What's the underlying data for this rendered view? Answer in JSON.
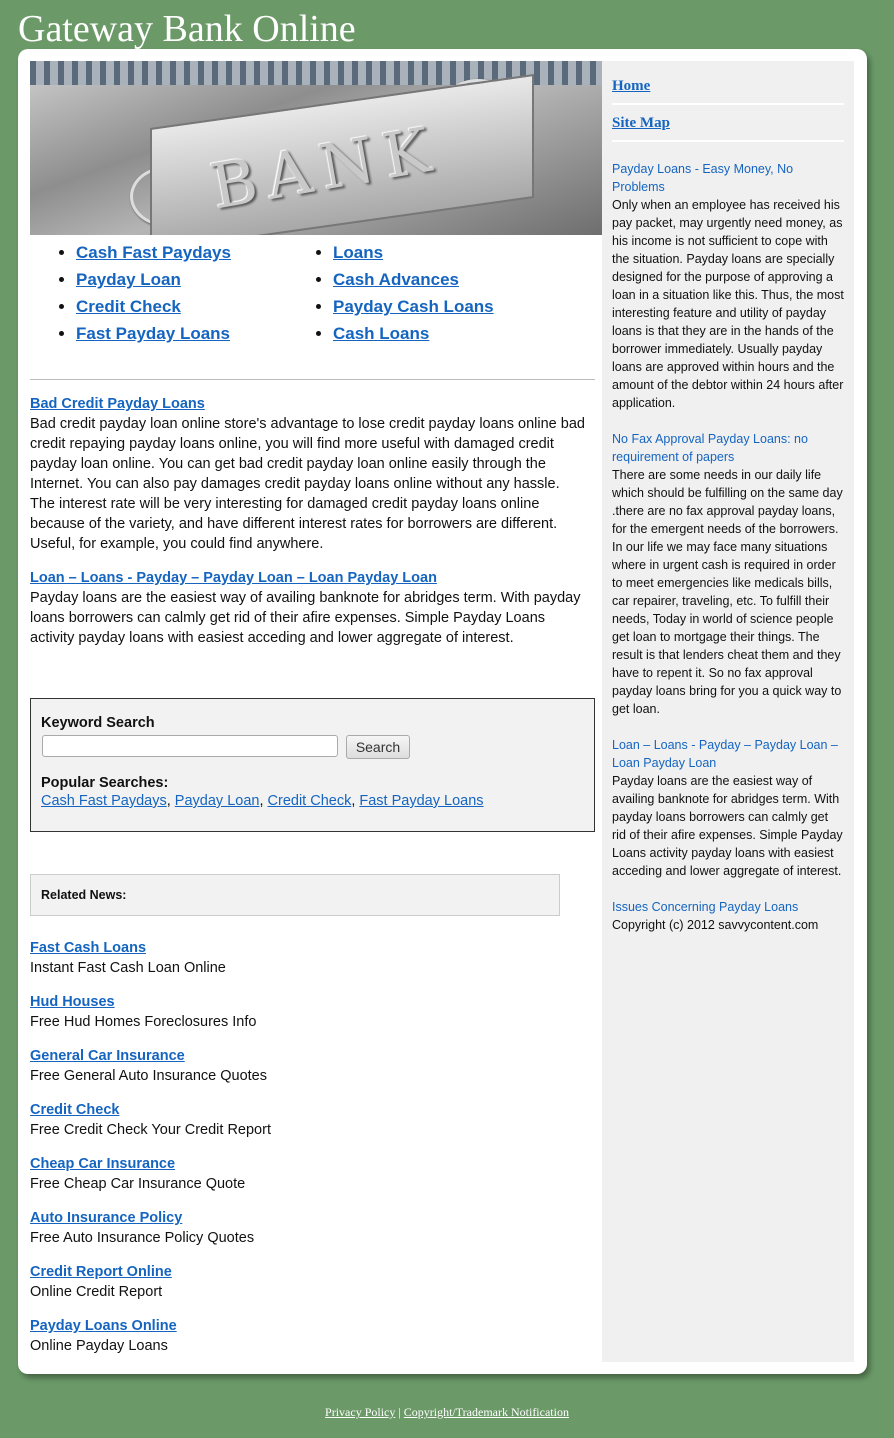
{
  "site": {
    "title": "Gateway Bank Online"
  },
  "hero": {
    "word": "BANK"
  },
  "top_links": {
    "col1": [
      "Cash Fast Paydays",
      "Payday Loan",
      "Credit Check",
      "Fast Payday Loans"
    ],
    "col2": [
      "Loans",
      "Cash Advances",
      "Payday Cash Loans",
      "Cash Loans"
    ]
  },
  "articles": [
    {
      "title": "Bad Credit Payday Loans",
      "body": "Bad credit payday loan online store's advantage to lose credit payday loans online bad credit repaying payday loans online, you will find more useful with damaged credit payday loan online. You can get bad credit payday loan online easily through the Internet. You can also pay damages credit payday loans online without any hassle. The interest rate will be very interesting for damaged credit payday loans online because of the variety, and have different interest rates for borrowers are different. Useful, for example, you could find anywhere."
    },
    {
      "title": "Loan – Loans - Payday – Payday Loan – Loan Payday Loan",
      "body": "Payday loans are the easiest way of availing banknote for abridges term. With payday loans borrowers can calmly get rid of their afire expenses. Simple Payday Loans activity payday loans with easiest acceding and lower aggregate of interest."
    }
  ],
  "search": {
    "label": "Keyword Search",
    "placeholder": "",
    "button": "Search",
    "popular_label": "Popular Searches:",
    "popular": [
      "Cash Fast Paydays",
      "Payday Loan",
      "Credit Check",
      "Fast Payday Loans"
    ],
    "separator": ", "
  },
  "related": {
    "label": "Related News:"
  },
  "news": [
    {
      "title": "Fast Cash Loans",
      "desc": "Instant Fast Cash Loan Online"
    },
    {
      "title": "Hud Houses",
      "desc": "Free Hud Homes Foreclosures Info"
    },
    {
      "title": "General Car Insurance",
      "desc": "Free General Auto Insurance Quotes"
    },
    {
      "title": "Credit Check",
      "desc": "Free Credit Check Your Credit Report"
    },
    {
      "title": "Cheap Car Insurance",
      "desc": "Free Cheap Car Insurance Quote"
    },
    {
      "title": "Auto Insurance Policy",
      "desc": "Free Auto Insurance Policy Quotes"
    },
    {
      "title": "Credit Report Online",
      "desc": "Online Credit Report"
    },
    {
      "title": "Payday Loans Online",
      "desc": "Online Payday Loans"
    }
  ],
  "sidebar": {
    "nav": [
      "Home",
      "Site Map"
    ],
    "posts": [
      {
        "title": "Payday Loans - Easy Money, No Problems",
        "body": "Only when an employee has received his pay packet, may urgently need money, as his income is not sufficient to cope with the situation. Payday loans are specially designed for the purpose of approving a loan in a situation like this. Thus, the most interesting feature and utility of payday loans is that they are in the hands of the borrower immediately. Usually payday loans are approved within hours and the amount of the debtor within 24 hours after application."
      },
      {
        "title": "No Fax Approval Payday Loans: no requirement of papers",
        "body": "There are some needs in our daily life which should be fulfilling on the same day .there are no fax approval payday loans, for the emergent needs of the borrowers. In our life we may face many situations where in urgent cash is required in order to meet emergencies like medicals bills, car repairer, traveling, etc. To fulfill their needs, Today in world of science people get loan to mortgage their things. The result is that lenders cheat them and they have to repent it. So no fax approval payday loans bring for you a quick way to get loan."
      },
      {
        "title": "Loan – Loans - Payday – Payday Loan – Loan Payday Loan",
        "body": "Payday loans are the easiest way of availing banknote for abridges term. With payday loans borrowers can calmly get rid of their afire expenses. Simple Payday Loans activity payday loans with easiest acceding and lower aggregate of interest."
      },
      {
        "title": "Issues Concerning Payday Loans",
        "body": "Copyright (c) 2012 savvycontent.com"
      }
    ]
  },
  "footer": {
    "privacy": "Privacy Policy",
    "separator": "|",
    "copyright": "Copyright/Trademark Notification"
  }
}
